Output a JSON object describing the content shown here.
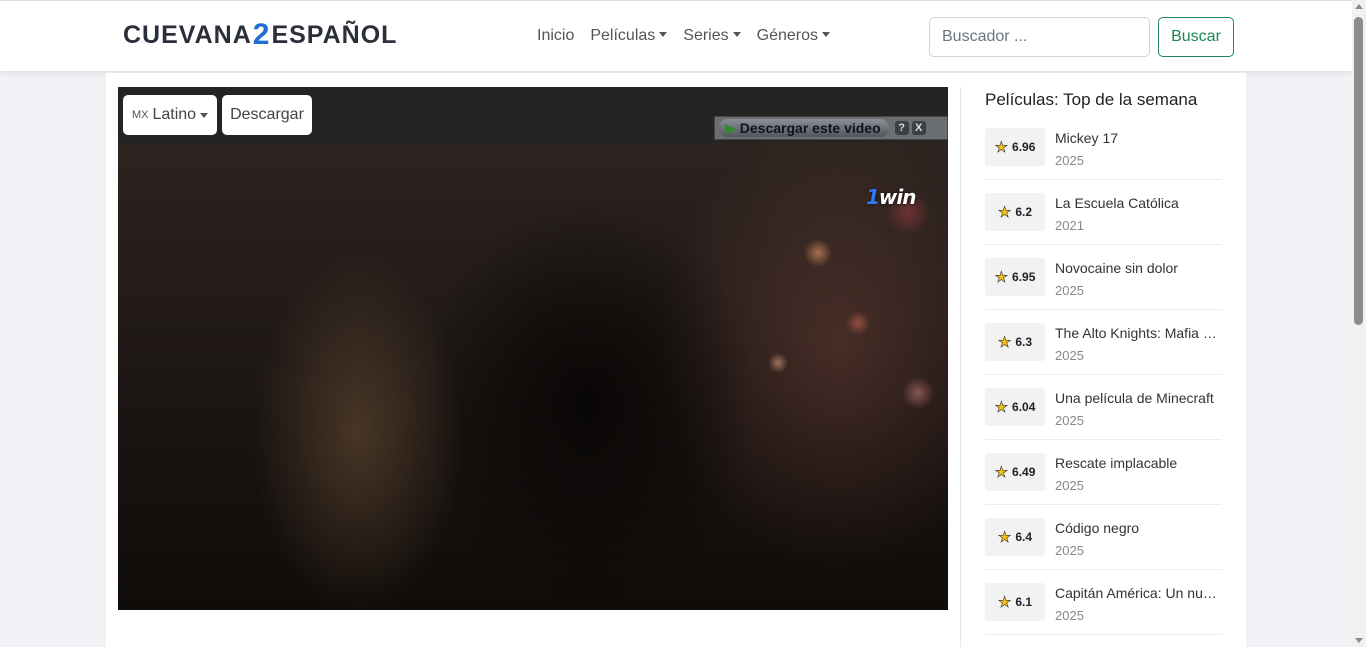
{
  "logo": {
    "part1": "CUEVANA",
    "part2": "2",
    "part3": "ESPAÑOL"
  },
  "nav": {
    "inicio": "Inicio",
    "peliculas": "Películas",
    "series": "Series",
    "generos": "Géneros"
  },
  "search": {
    "placeholder": "Buscador ...",
    "value": "",
    "button": "Buscar"
  },
  "player": {
    "lang_flag": "MX",
    "lang_label": "Latino",
    "download_label": "Descargar",
    "ad_download_label": "Descargar este video",
    "ad_help": "?",
    "ad_close": "X",
    "sponsor_logo": "1win"
  },
  "sidebar": {
    "title": "Películas: Top de la semana",
    "items": [
      {
        "rating": "6.96",
        "title": "Mickey 17",
        "year": "2025"
      },
      {
        "rating": "6.2",
        "title": "La Escuela Católica",
        "year": "2021"
      },
      {
        "rating": "6.95",
        "title": "Novocaine sin dolor",
        "year": "2025"
      },
      {
        "rating": "6.3",
        "title": "The Alto Knights: Mafia …",
        "year": "2025"
      },
      {
        "rating": "6.04",
        "title": "Una película de Minecraft",
        "year": "2025"
      },
      {
        "rating": "6.49",
        "title": "Rescate implacable",
        "year": "2025"
      },
      {
        "rating": "6.4",
        "title": "Código negro",
        "year": "2025"
      },
      {
        "rating": "6.1",
        "title": "Capitán América: Un nu…",
        "year": "2025"
      }
    ]
  },
  "colors": {
    "brand_blue": "#1f6fd1",
    "search_green": "#198754",
    "star": "#f3c318"
  }
}
